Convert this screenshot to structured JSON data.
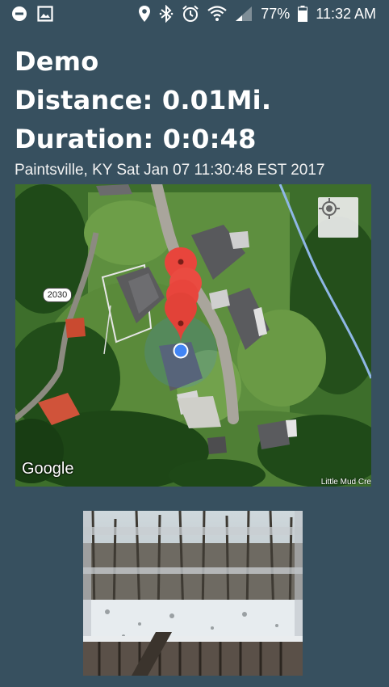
{
  "status_bar": {
    "battery_percent": "77%",
    "time": "11:32 AM",
    "icons": [
      "do-not-disturb-icon",
      "gallery-icon",
      "location-icon",
      "bluetooth-icon",
      "alarm-icon",
      "wifi-icon",
      "signal-icon",
      "battery-icon"
    ]
  },
  "header": {
    "title": "Demo",
    "distance": "Distance: 0.01Mi.",
    "duration": "Duration: 0:0:48"
  },
  "location_line": "Paintsville, KY Sat Jan 07 11:30:48 EST 2017",
  "map": {
    "attribution": "Google",
    "road_shield": "2030",
    "creek_label": "Little Mud Cre",
    "marker_count": 4,
    "accent_marker_color": "#e8453c",
    "current_location_color": "#4285f4"
  },
  "photo": {
    "icon": "snow-deck-photo"
  }
}
